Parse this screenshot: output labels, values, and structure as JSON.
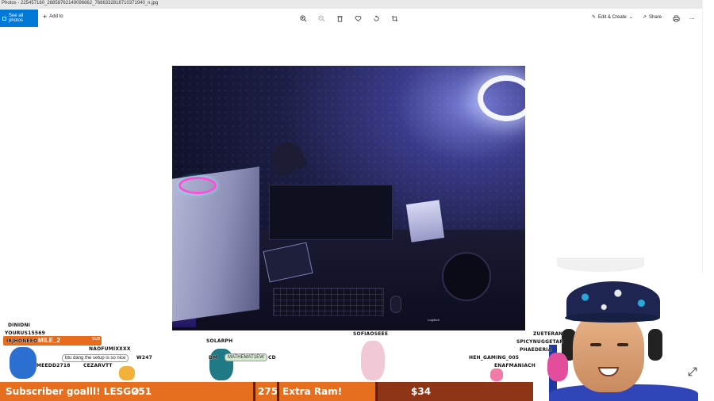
{
  "window": {
    "title": "Photos - 225457160_28858762149096662_7686332818710371940_n.jpg"
  },
  "toolbar": {
    "see_all_label": "See all photos",
    "add_to_label": "Add to",
    "edit_create_label": "Edit & Create",
    "share_label": "Share",
    "more_label": "..."
  },
  "photo": {
    "watermark": "Logitech"
  },
  "chat": {
    "names_left": [
      "DINIDNI",
      "YOURUS15569",
      "IRJHONEEO",
      "NAOFUMIXXXX",
      "W247",
      "CEZARVTT",
      "MEEDD2718"
    ],
    "sub_name": "MILE_2",
    "sub_tag": "SUB",
    "message_left": "btu dang the setup is so nice",
    "name_center": "SOLARPH",
    "bubble_center": "MATHEMAT1EW",
    "name_center_short": "DM",
    "name_center_right": "CD",
    "name_mid": "SOFIAOSEEE",
    "names_right": [
      "ZUETERAN",
      "SPICYNUGGETAR",
      "PHAEDERIA",
      "HEH_GAMING_005",
      "ENAFMANIACH"
    ]
  },
  "goal": {
    "label": "Subscriber goalll! LESGO",
    "current": "251",
    "target": "275",
    "next_label": "Extra Ram!",
    "amount": "$34",
    "progress_fraction": 0.4
  },
  "colors": {
    "accent": "#0078d7",
    "goal_fill": "#e56f1f",
    "goal_bg": "#8e3417"
  },
  "icons": [
    "zoom-in-icon",
    "zoom-out-icon",
    "delete-icon",
    "heart-icon",
    "rotate-icon",
    "crop-icon",
    "edit-icon",
    "share-icon",
    "print-icon",
    "expand-icon"
  ]
}
